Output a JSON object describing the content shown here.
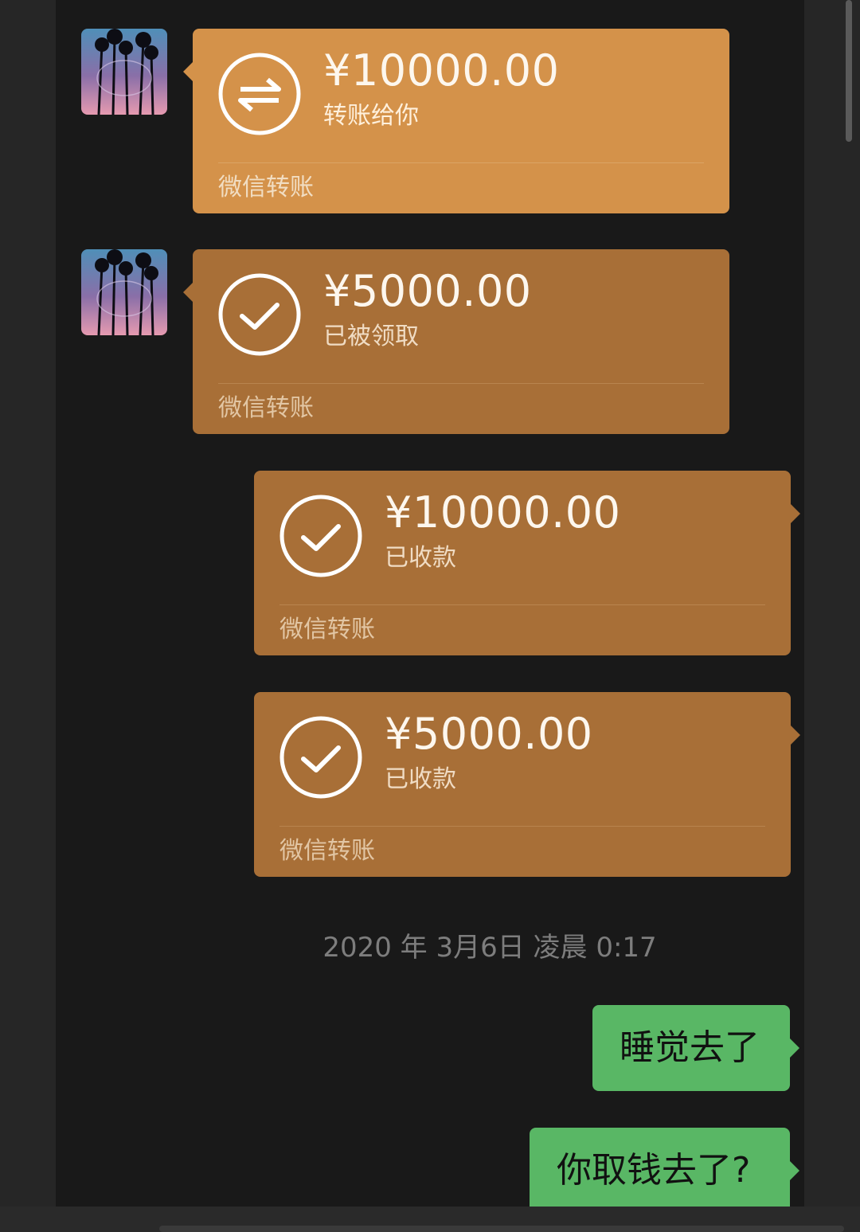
{
  "messages": [
    {
      "amount": "¥10000.00",
      "status": "转账给你",
      "footer": "微信转账",
      "icon": "transfer-arrows-icon"
    },
    {
      "amount": "¥5000.00",
      "status": "已被领取",
      "footer": "微信转账",
      "icon": "check-circle-icon"
    },
    {
      "amount": "¥10000.00",
      "status": "已收款",
      "footer": "微信转账",
      "icon": "check-circle-icon"
    },
    {
      "amount": "¥5000.00",
      "status": "已收款",
      "footer": "微信转账",
      "icon": "check-circle-icon"
    }
  ],
  "timestamp": "2020 年 3月6日 凌晨 0:17",
  "texts": [
    {
      "text": "睡觉去了"
    },
    {
      "text": "你取钱去了?"
    }
  ],
  "colors": {
    "pending": "#d4924a",
    "received": "#a86f37",
    "sent_text": "#59b765",
    "background": "#191919"
  }
}
